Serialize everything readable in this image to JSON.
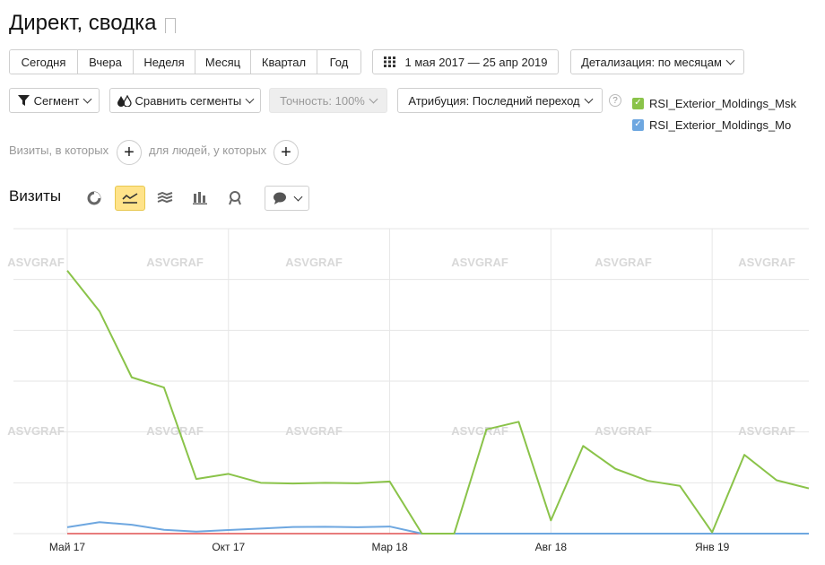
{
  "page": {
    "title": "Директ, сводка"
  },
  "periods": [
    "Сегодня",
    "Вчера",
    "Неделя",
    "Месяц",
    "Квартал",
    "Год"
  ],
  "date_range": "1 мая 2017 — 25 апр 2019",
  "detail": "Детализация: по месяцам",
  "segment": "Сегмент",
  "compare": "Сравнить сегменты",
  "accuracy": "Точность: 100%",
  "attribution": "Атрибуция: Последний переход",
  "conditions": {
    "visits_label": "Визиты, в которых",
    "people_label": "для людей, у которых"
  },
  "metric": {
    "title": "Визиты"
  },
  "watermark": "ASVGRAF",
  "colors": {
    "series_msk": "#8ac349",
    "series_mo": "#6ea7e0",
    "active_view": "#ffe38a"
  },
  "icons": {
    "view_pie": "pie-icon",
    "view_line": "line-chart-icon",
    "view_area": "area-icon",
    "view_bar": "bar-icon",
    "view_map": "map-pin-icon",
    "comment": "comment-icon"
  },
  "chart_data": {
    "type": "line",
    "x": [
      "2017-05",
      "2017-06",
      "2017-07",
      "2017-08",
      "2017-09",
      "2017-10",
      "2017-11",
      "2017-12",
      "2018-01",
      "2018-02",
      "2018-03",
      "2018-04",
      "2018-05",
      "2018-06",
      "2018-07",
      "2018-08",
      "2018-09",
      "2018-10",
      "2018-11",
      "2018-12",
      "2019-01",
      "2019-02",
      "2019-03",
      "2019-04"
    ],
    "x_tick_labels": [
      {
        "x": "2017-05",
        "label": "Май 17"
      },
      {
        "x": "2017-10",
        "label": "Окт 17"
      },
      {
        "x": "2018-03",
        "label": "Мар 18"
      },
      {
        "x": "2018-08",
        "label": "Авг 18"
      },
      {
        "x": "2019-01",
        "label": "Янв 19"
      }
    ],
    "ylim": [
      0,
      1200
    ],
    "grid": true,
    "legend": "top-right",
    "series": [
      {
        "name": "RSI_Exterior_Moldings_Msk",
        "color": "#8ac349",
        "values": [
          1035,
          875,
          615,
          575,
          215,
          235,
          200,
          197,
          200,
          198,
          205,
          0,
          0,
          410,
          440,
          52,
          345,
          255,
          208,
          188,
          5,
          310,
          210,
          178
        ]
      },
      {
        "name": "RSI_Exterior_Moldings_Mo",
        "color": "#6ea7e0",
        "values": [
          25,
          45,
          35,
          15,
          8,
          14,
          20,
          26,
          27,
          25,
          28,
          0,
          0,
          0,
          0,
          0,
          0,
          0,
          0,
          0,
          0,
          0,
          0,
          0
        ]
      }
    ]
  }
}
